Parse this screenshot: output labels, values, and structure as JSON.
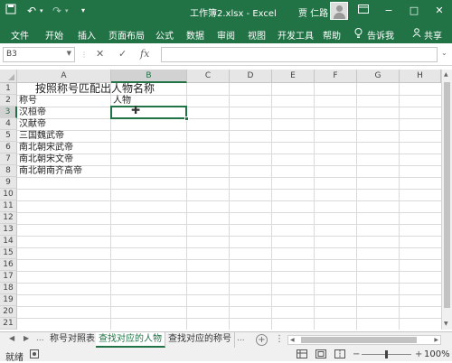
{
  "titlebar": {
    "save_icon": "save-icon",
    "title": "工作簿2.xlsx - Excel",
    "user": "贾 仁路",
    "min": "−",
    "restore": "□",
    "close": "✕"
  },
  "ribbon_tabs": [
    "文件",
    "开始",
    "插入",
    "页面布局",
    "公式",
    "数据",
    "审阅",
    "视图",
    "开发工具",
    "帮助"
  ],
  "ribbon_right": {
    "tell": "告诉我",
    "share": "共享"
  },
  "formula_bar": {
    "name_box": "B3",
    "fx": "fx",
    "value": ""
  },
  "grid": {
    "columns": [
      "A",
      "B",
      "C",
      "D",
      "E",
      "F",
      "G",
      "H"
    ],
    "rows": [
      "1",
      "2",
      "3",
      "4",
      "5",
      "6",
      "7",
      "8",
      "9",
      "10",
      "11",
      "12",
      "13",
      "14",
      "15",
      "16",
      "17",
      "18",
      "19",
      "20",
      "21"
    ],
    "selected_cell": "B3",
    "cells": {
      "a1": "按照称号匹配出人物名称",
      "a2": "称号",
      "b2": "人物",
      "a3": "汉桓帝",
      "a4": "汉献帝",
      "a5": "三国魏武帝",
      "a6": "南北朝宋武帝",
      "a7": "南北朝宋文帝",
      "a8": "南北朝南齐高帝"
    }
  },
  "sheets": {
    "tabs": [
      "称号对照表",
      "查找对应的人物",
      "查找对应的称号"
    ],
    "active_index": 1,
    "more": "...",
    "add": "+"
  },
  "status": {
    "ready": "就绪",
    "zoom": "100%",
    "minus": "−",
    "plus": "+"
  },
  "colors": {
    "accent": "#217346",
    "header_bg": "#e6e6e6",
    "gridline": "#dadada"
  }
}
